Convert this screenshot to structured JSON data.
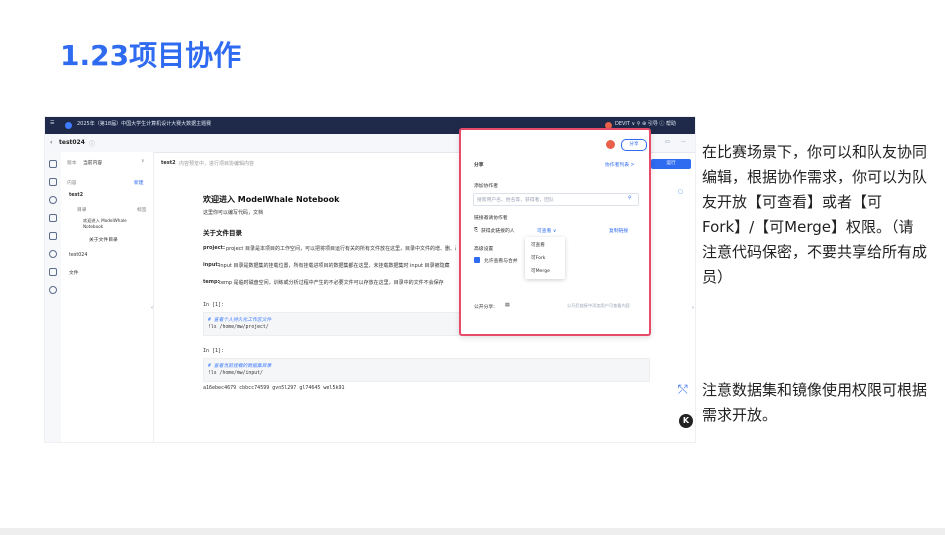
{
  "slide": {
    "title": "1.23项目协作",
    "description": "在比赛场景下，你可以和队友协同编辑，根据协作需求，你可以为队友开放【可查看】或者【可Fork】/【可Merge】权限。（请注意代码保密，不要共享给所有成员）",
    "note": "注意数据集和镜像使用权限可根据需求开放。",
    "k_label": "K"
  },
  "app": {
    "topbar_title": "2025年（第18届）中国大学生计算机设计大赛大数据主题赛",
    "topbar_right": "DEVIT ∨  ⚲  ⊕ 引导  ⓘ 帮助",
    "project_name": "test024",
    "sidebar": {
      "version_label": "版本",
      "version_value": "当前内容",
      "content_label": "内容",
      "new_label": "新建",
      "items": [
        "test2",
        "目录",
        "欢迎进入 ModelWhale Notebook",
        "关于文件目录",
        "test024",
        "文件"
      ],
      "tag_label": "标签"
    },
    "notebook": {
      "tab_name": "test2",
      "tab_hint": "内容预览中，进行项目协编辑内容",
      "heading": "欢迎进入 ModelWhale Notebook",
      "subtitle": "这里你可以编写代码，文档",
      "section": "关于文件目录",
      "line1_key": "project:",
      "line1": "project 目录是本项目的工作空间，可以把将项目运行有关的所有文件放在这里，目录中文件的增、删、改操作都会被保留",
      "line2_key": "input:",
      "line2": "input 目录是数据集的挂载位置，所有挂载进项目的数据集都在这里，未挂载数据集时 input 目录被隐藏",
      "line3_key": "temp:",
      "line3": "temp 是临时磁盘空间，训练或分析过程中产生的不必要文件可以存放在这里，目录中的文件不会保存",
      "cell1_prompt": "In [1]:",
      "cell1_comment": "# 查看个人持久化工作区文件",
      "cell1_code": "!ls /home/mw/project/",
      "cell2_prompt": "In [1]:",
      "cell2_comment": "# 查看当前挂载的数据集目录",
      "cell2_code": "!ls /home/mw/input/",
      "output": "a16ebec4679   cbbcc74599   gvn5l297   gl74645   wel5k91",
      "run_label": "运行"
    },
    "share_popup": {
      "title": "分享",
      "collab_list": "协作者列表 >",
      "add_label": "添加协作者",
      "add_placeholder": "搜索用户名、姓名等，获得者，团队",
      "invite_label": "链接邀请协作者",
      "invite_text": "获得此链接的人",
      "invite_perm": "可查看 ∨",
      "copy_link": "复制链接",
      "advanced_label": "高级设置",
      "allow_text": "允许查看与合并",
      "owner_label": "公开分享:",
      "footer": "公开后链接中添加用户可查看内容",
      "share_button": "分享",
      "options": [
        "可查看",
        "可Fork",
        "可Merge"
      ]
    }
  },
  "colors": {
    "accent": "#2f6bf0",
    "highlight": "#e84a6a",
    "topbar": "#1f2a4a"
  }
}
